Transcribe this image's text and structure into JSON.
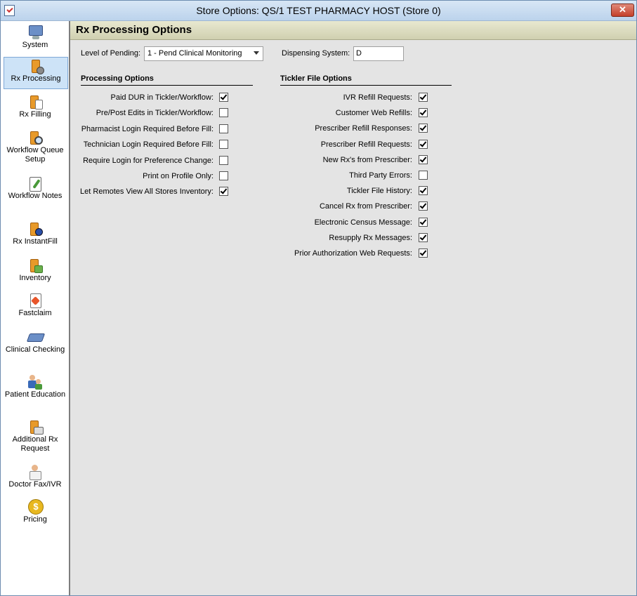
{
  "window": {
    "title": "Store Options: QS/1 TEST PHARMACY HOST (Store 0)",
    "close_label": "✕"
  },
  "sidebar": {
    "items": [
      {
        "label": "System",
        "icon": "computer-icon"
      },
      {
        "label": "Rx Processing",
        "icon": "bottle-gear-icon",
        "selected": true
      },
      {
        "label": "Rx Filling",
        "icon": "bottle-paper-icon"
      },
      {
        "label": "Workflow Queue Setup",
        "icon": "bottle-magnifier-icon"
      },
      {
        "label": "Workflow Notes",
        "icon": "notepad-pencil-icon"
      },
      {
        "label": "Rx InstantFill",
        "icon": "bottle-disc-icon"
      },
      {
        "label": "Inventory",
        "icon": "bottle-boxes-icon"
      },
      {
        "label": "Fastclaim",
        "icon": "document-arrow-icon"
      },
      {
        "label": "Clinical Checking",
        "icon": "book-icon"
      },
      {
        "label": "Patient Education",
        "icon": "people-icon"
      },
      {
        "label": "Additional Rx Request",
        "icon": "bottle-document-icon"
      },
      {
        "label": "Doctor Fax/IVR",
        "icon": "doctor-icon"
      },
      {
        "label": "Pricing",
        "icon": "dollar-coin-icon"
      }
    ]
  },
  "header": {
    "title": "Rx Processing Options"
  },
  "pending": {
    "label": "Level of Pending:",
    "value": "1 - Pend Clinical Monitoring"
  },
  "dispensing": {
    "label": "Dispensing System:",
    "value": "D"
  },
  "processing": {
    "title": "Processing Options",
    "options": [
      {
        "label": "Paid DUR in Tickler/Workflow:",
        "checked": true
      },
      {
        "label": "Pre/Post Edits in Tickler/Workflow:",
        "checked": false
      },
      {
        "label": "Pharmacist Login Required Before Fill:",
        "checked": false
      },
      {
        "label": "Technician Login Required Before Fill:",
        "checked": false
      },
      {
        "label": "Require Login for Preference Change:",
        "checked": false
      },
      {
        "label": "Print on Profile Only:",
        "checked": false
      },
      {
        "label": "Let Remotes View All Stores Inventory:",
        "checked": true
      }
    ]
  },
  "tickler": {
    "title": "Tickler File Options",
    "options": [
      {
        "label": "IVR Refill Requests:",
        "checked": true
      },
      {
        "label": "Customer Web Refills:",
        "checked": true
      },
      {
        "label": "Prescriber Refill Responses:",
        "checked": true
      },
      {
        "label": "Prescriber Refill Requests:",
        "checked": true
      },
      {
        "label": "New Rx's from Prescriber:",
        "checked": true
      },
      {
        "label": "Third Party Errors:",
        "checked": false
      },
      {
        "label": "Tickler File History:",
        "checked": true
      },
      {
        "label": "Cancel Rx from Prescriber:",
        "checked": true
      },
      {
        "label": "Electronic Census Message:",
        "checked": true
      },
      {
        "label": "Resupply Rx Messages:",
        "checked": true
      },
      {
        "label": "Prior Authorization Web Requests:",
        "checked": true
      }
    ]
  }
}
